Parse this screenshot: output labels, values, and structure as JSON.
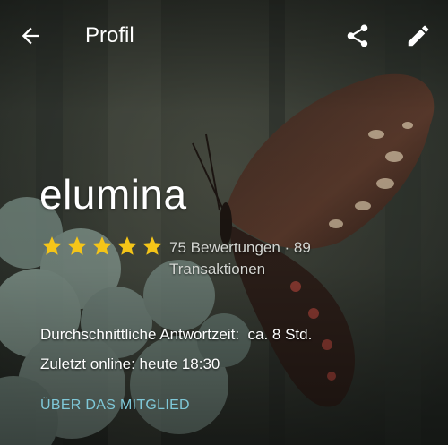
{
  "header": {
    "title": "Profil",
    "back_icon": "arrow-back-icon",
    "share_icon": "share-icon",
    "edit_icon": "edit-pencil-icon"
  },
  "profile": {
    "username": "elumina",
    "rating": 5,
    "rating_max": 5,
    "reviews_text": "75 Bewertungen · 89 Transaktionen",
    "response_time": "Durchschnittliche Antwortzeit:  ca. 8 Std.",
    "last_online": "Zuletzt online: heute 18:30",
    "about_label": "ÜBER DAS MITGLIED"
  },
  "colors": {
    "star": "#f5c518",
    "link": "#7fc8d8"
  }
}
